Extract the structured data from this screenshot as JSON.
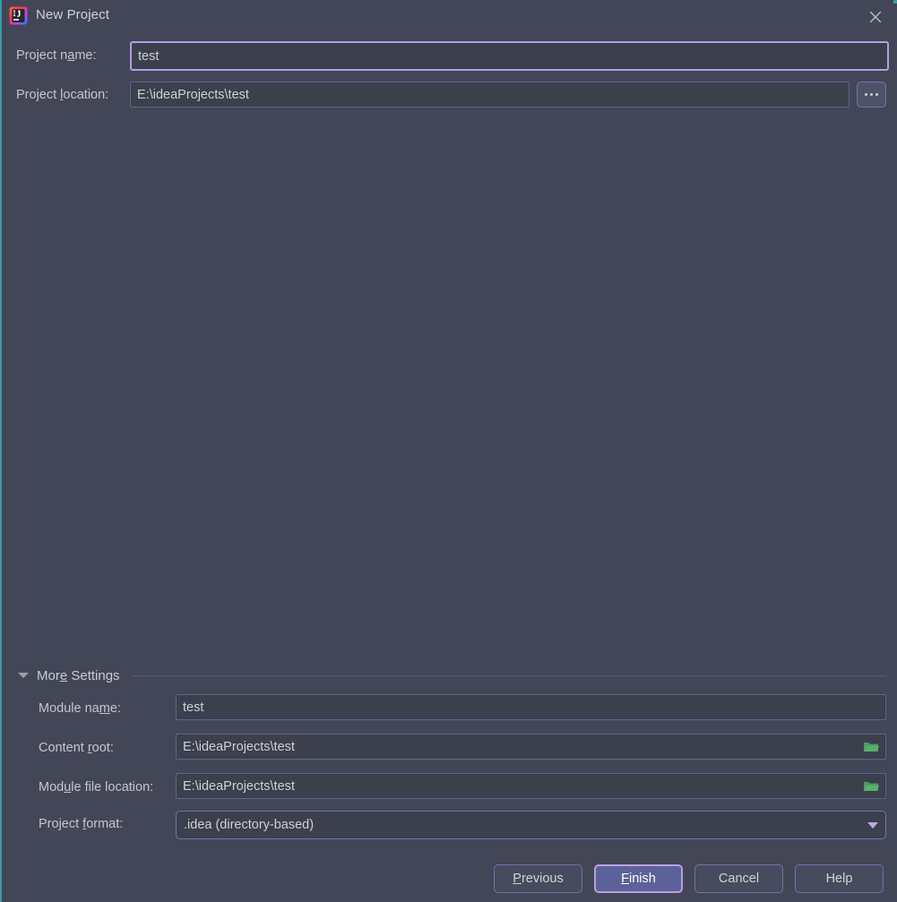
{
  "window": {
    "title": "New Project",
    "app_icon": "intellij-idea-icon",
    "close_icon": "close-icon",
    "accent_color": "#3a9ca8",
    "background_color": "#434656"
  },
  "form": {
    "project_name": {
      "label_prefix": "Project n",
      "label_mnemonic": "a",
      "label_suffix": "me:",
      "value": "test",
      "focused": true
    },
    "project_location": {
      "label_prefix": "Project ",
      "label_mnemonic": "l",
      "label_suffix": "ocation:",
      "value": "E:\\ideaProjects\\test",
      "focused": false
    },
    "browse_button": {
      "icon": "ellipsis-icon",
      "dots": 3
    }
  },
  "more_settings": {
    "label_prefix": "Mor",
    "label_mnemonic": "e",
    "label_suffix": " Settings",
    "expanded": true,
    "toggle_icon": "triangle-down-icon",
    "fields": [
      {
        "name": "module-name",
        "label_prefix": "Module na",
        "label_mnemonic": "m",
        "label_suffix": "e:",
        "value": "test",
        "has_folder_icon": false
      },
      {
        "name": "content-root",
        "label_prefix": "Content ",
        "label_mnemonic": "r",
        "label_suffix": "oot:",
        "value": "E:\\ideaProjects\\test",
        "has_folder_icon": true
      },
      {
        "name": "module-file-location",
        "label_prefix": "Mod",
        "label_mnemonic": "u",
        "label_suffix": "le file location:",
        "value": "E:\\ideaProjects\\test",
        "has_folder_icon": true
      }
    ],
    "project_format": {
      "label_prefix": "Project ",
      "label_mnemonic": "f",
      "label_suffix": "ormat:",
      "selected": ".idea (directory-based)",
      "arrow_icon": "chevron-down-icon",
      "arrow_color": "#c2a7ee"
    }
  },
  "buttons": {
    "previous": {
      "prefix": "",
      "mnemonic": "P",
      "suffix": "revious",
      "default": false
    },
    "finish": {
      "prefix": "",
      "mnemonic": "F",
      "suffix": "inish",
      "default": true,
      "fill_color": "#5c6299",
      "border_color": "#b99fe0"
    },
    "cancel": {
      "prefix": "Cancel",
      "mnemonic": "",
      "suffix": "",
      "default": false
    },
    "help": {
      "prefix": "Help",
      "mnemonic": "",
      "suffix": "",
      "default": false
    }
  }
}
